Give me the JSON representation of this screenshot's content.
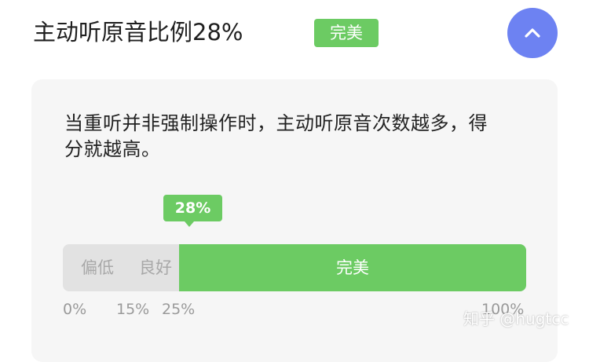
{
  "header": {
    "title": "主动听原音比例28%",
    "badge": "完美"
  },
  "collapse_button": {
    "icon": "chevron-up-icon"
  },
  "card": {
    "description": "当重听并非强制操作时，主动听原音次数越多，得分就越高。",
    "indicator": {
      "value_percent": 28,
      "label": "28%"
    },
    "scale": {
      "segments": [
        {
          "label": "偏低",
          "from": 0,
          "to": 15,
          "color": "#e2e2e2"
        },
        {
          "label": "良好",
          "from": 15,
          "to": 25,
          "color": "#e2e2e2"
        },
        {
          "label": "完美",
          "from": 25,
          "to": 100,
          "color": "#6ccb63"
        }
      ],
      "ticks": [
        "0%",
        "15%",
        "25%",
        "100%"
      ]
    }
  },
  "watermark": "知乎 @hugtcc",
  "colors": {
    "accent_green": "#6ccb63",
    "button_blue": "#6d82f2",
    "card_background": "#f6f6f6"
  }
}
